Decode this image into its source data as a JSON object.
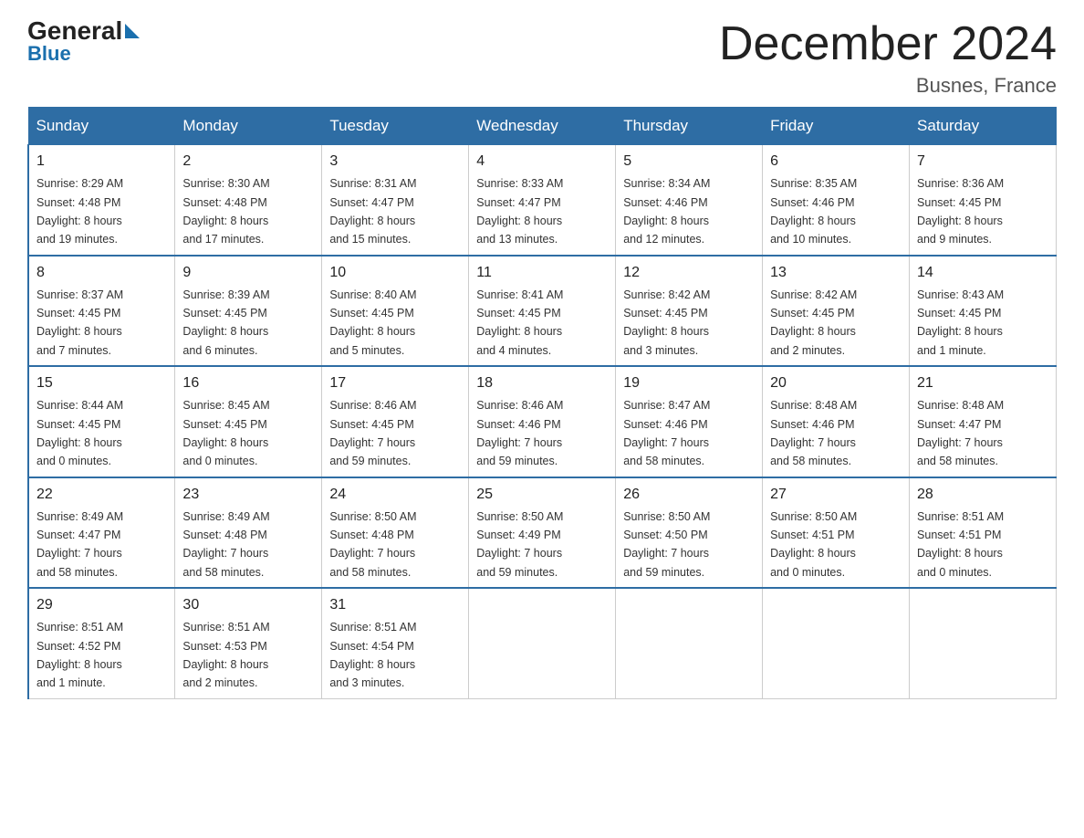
{
  "header": {
    "logo_general": "General",
    "logo_blue": "Blue",
    "title": "December 2024",
    "subtitle": "Busnes, France"
  },
  "weekdays": [
    "Sunday",
    "Monday",
    "Tuesday",
    "Wednesday",
    "Thursday",
    "Friday",
    "Saturday"
  ],
  "weeks": [
    [
      {
        "day": "1",
        "sunrise": "8:29 AM",
        "sunset": "4:48 PM",
        "daylight": "8 hours and 19 minutes."
      },
      {
        "day": "2",
        "sunrise": "8:30 AM",
        "sunset": "4:48 PM",
        "daylight": "8 hours and 17 minutes."
      },
      {
        "day": "3",
        "sunrise": "8:31 AM",
        "sunset": "4:47 PM",
        "daylight": "8 hours and 15 minutes."
      },
      {
        "day": "4",
        "sunrise": "8:33 AM",
        "sunset": "4:47 PM",
        "daylight": "8 hours and 13 minutes."
      },
      {
        "day": "5",
        "sunrise": "8:34 AM",
        "sunset": "4:46 PM",
        "daylight": "8 hours and 12 minutes."
      },
      {
        "day": "6",
        "sunrise": "8:35 AM",
        "sunset": "4:46 PM",
        "daylight": "8 hours and 10 minutes."
      },
      {
        "day": "7",
        "sunrise": "8:36 AM",
        "sunset": "4:45 PM",
        "daylight": "8 hours and 9 minutes."
      }
    ],
    [
      {
        "day": "8",
        "sunrise": "8:37 AM",
        "sunset": "4:45 PM",
        "daylight": "8 hours and 7 minutes."
      },
      {
        "day": "9",
        "sunrise": "8:39 AM",
        "sunset": "4:45 PM",
        "daylight": "8 hours and 6 minutes."
      },
      {
        "day": "10",
        "sunrise": "8:40 AM",
        "sunset": "4:45 PM",
        "daylight": "8 hours and 5 minutes."
      },
      {
        "day": "11",
        "sunrise": "8:41 AM",
        "sunset": "4:45 PM",
        "daylight": "8 hours and 4 minutes."
      },
      {
        "day": "12",
        "sunrise": "8:42 AM",
        "sunset": "4:45 PM",
        "daylight": "8 hours and 3 minutes."
      },
      {
        "day": "13",
        "sunrise": "8:42 AM",
        "sunset": "4:45 PM",
        "daylight": "8 hours and 2 minutes."
      },
      {
        "day": "14",
        "sunrise": "8:43 AM",
        "sunset": "4:45 PM",
        "daylight": "8 hours and 1 minute."
      }
    ],
    [
      {
        "day": "15",
        "sunrise": "8:44 AM",
        "sunset": "4:45 PM",
        "daylight": "8 hours and 0 minutes."
      },
      {
        "day": "16",
        "sunrise": "8:45 AM",
        "sunset": "4:45 PM",
        "daylight": "8 hours and 0 minutes."
      },
      {
        "day": "17",
        "sunrise": "8:46 AM",
        "sunset": "4:45 PM",
        "daylight": "7 hours and 59 minutes."
      },
      {
        "day": "18",
        "sunrise": "8:46 AM",
        "sunset": "4:46 PM",
        "daylight": "7 hours and 59 minutes."
      },
      {
        "day": "19",
        "sunrise": "8:47 AM",
        "sunset": "4:46 PM",
        "daylight": "7 hours and 58 minutes."
      },
      {
        "day": "20",
        "sunrise": "8:48 AM",
        "sunset": "4:46 PM",
        "daylight": "7 hours and 58 minutes."
      },
      {
        "day": "21",
        "sunrise": "8:48 AM",
        "sunset": "4:47 PM",
        "daylight": "7 hours and 58 minutes."
      }
    ],
    [
      {
        "day": "22",
        "sunrise": "8:49 AM",
        "sunset": "4:47 PM",
        "daylight": "7 hours and 58 minutes."
      },
      {
        "day": "23",
        "sunrise": "8:49 AM",
        "sunset": "4:48 PM",
        "daylight": "7 hours and 58 minutes."
      },
      {
        "day": "24",
        "sunrise": "8:50 AM",
        "sunset": "4:48 PM",
        "daylight": "7 hours and 58 minutes."
      },
      {
        "day": "25",
        "sunrise": "8:50 AM",
        "sunset": "4:49 PM",
        "daylight": "7 hours and 59 minutes."
      },
      {
        "day": "26",
        "sunrise": "8:50 AM",
        "sunset": "4:50 PM",
        "daylight": "7 hours and 59 minutes."
      },
      {
        "day": "27",
        "sunrise": "8:50 AM",
        "sunset": "4:51 PM",
        "daylight": "8 hours and 0 minutes."
      },
      {
        "day": "28",
        "sunrise": "8:51 AM",
        "sunset": "4:51 PM",
        "daylight": "8 hours and 0 minutes."
      }
    ],
    [
      {
        "day": "29",
        "sunrise": "8:51 AM",
        "sunset": "4:52 PM",
        "daylight": "8 hours and 1 minute."
      },
      {
        "day": "30",
        "sunrise": "8:51 AM",
        "sunset": "4:53 PM",
        "daylight": "8 hours and 2 minutes."
      },
      {
        "day": "31",
        "sunrise": "8:51 AM",
        "sunset": "4:54 PM",
        "daylight": "8 hours and 3 minutes."
      },
      null,
      null,
      null,
      null
    ]
  ],
  "labels": {
    "sunrise": "Sunrise:",
    "sunset": "Sunset:",
    "daylight": "Daylight:"
  }
}
